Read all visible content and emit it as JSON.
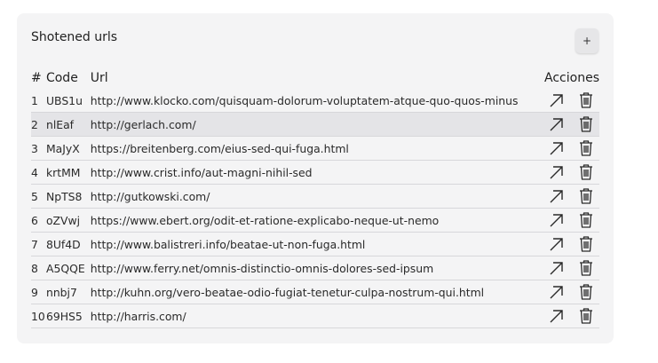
{
  "card": {
    "title": "Shotened urls",
    "add_label": "+"
  },
  "table": {
    "headers": {
      "num": "#",
      "code": "Code",
      "url": "Url",
      "actions": "Acciones"
    },
    "rows": [
      {
        "num": "1",
        "code": "UBS1u",
        "url": "http://www.klocko.com/quisquam-dolorum-voluptatem-atque-quo-quos-minus"
      },
      {
        "num": "2",
        "code": "nlEaf",
        "url": "http://gerlach.com/"
      },
      {
        "num": "3",
        "code": "MaJyX",
        "url": "https://breitenberg.com/eius-sed-qui-fuga.html"
      },
      {
        "num": "4",
        "code": "krtMM",
        "url": "http://www.crist.info/aut-magni-nihil-sed"
      },
      {
        "num": "5",
        "code": "NpTS8",
        "url": "http://gutkowski.com/"
      },
      {
        "num": "6",
        "code": "oZVwj",
        "url": "https://www.ebert.org/odit-et-ratione-explicabo-neque-ut-nemo"
      },
      {
        "num": "7",
        "code": "8Uf4D",
        "url": "http://www.balistreri.info/beatae-ut-non-fuga.html"
      },
      {
        "num": "8",
        "code": "A5QQE",
        "url": "http://www.ferry.net/omnis-distinctio-omnis-dolores-sed-ipsum"
      },
      {
        "num": "9",
        "code": "nnbj7",
        "url": "http://kuhn.org/vero-beatae-odio-fugiat-tenetur-culpa-nostrum-qui.html"
      },
      {
        "num": "10",
        "code": "69HS5",
        "url": "http://harris.com/"
      }
    ],
    "highlighted_row": 1
  },
  "icons": {
    "open": "arrow-up-right-icon",
    "delete": "trash-icon"
  },
  "colors": {
    "card_bg": "#f4f4f5",
    "highlight_row": "#e4e4e7",
    "divider": "#d7d7da"
  }
}
